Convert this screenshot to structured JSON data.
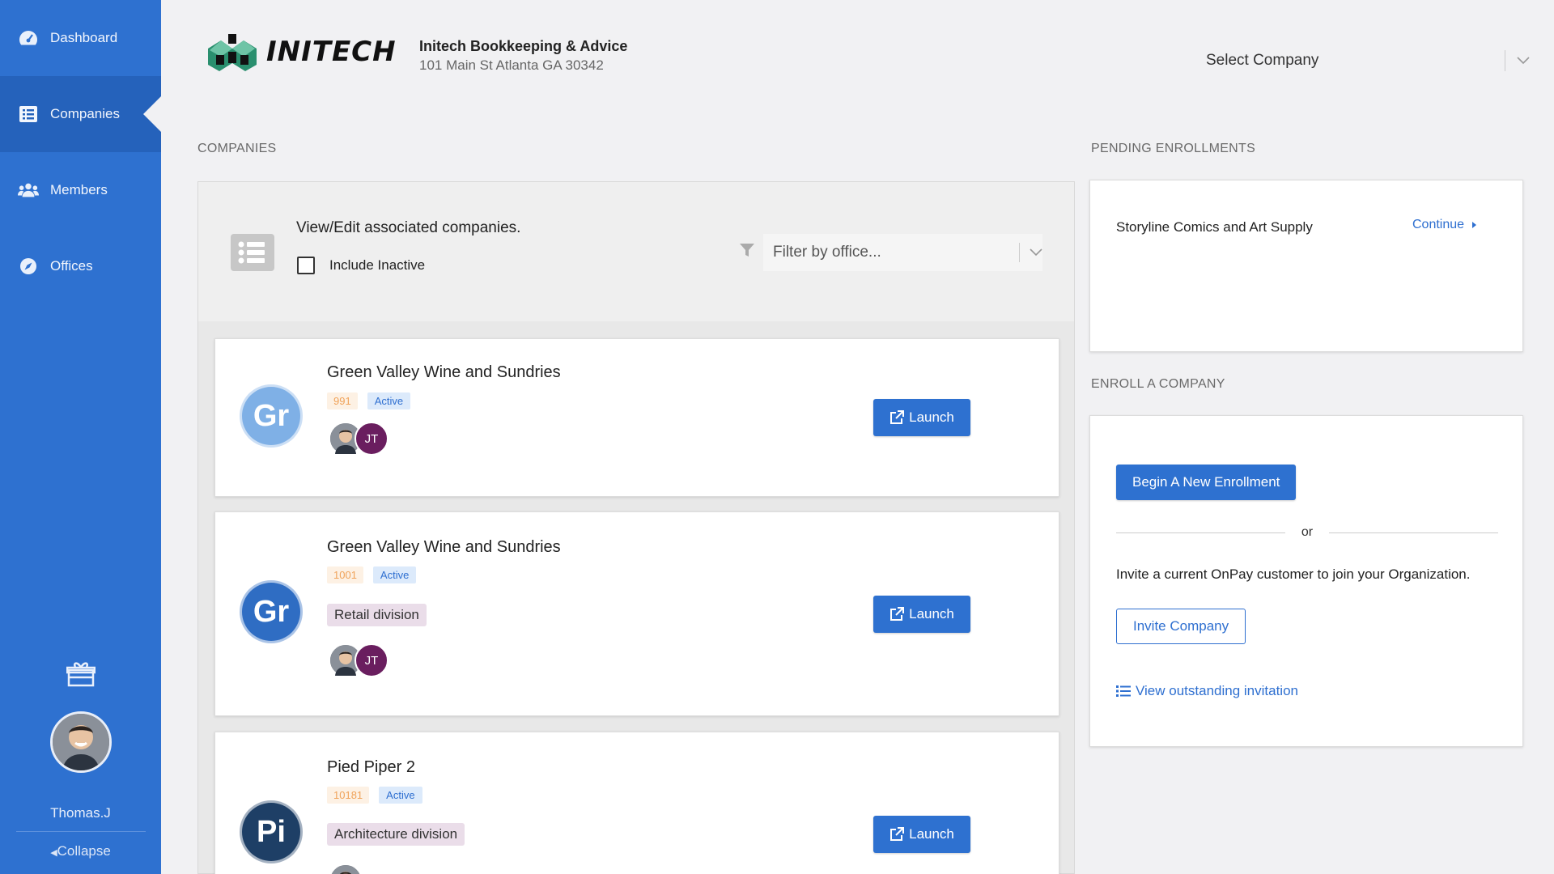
{
  "sidebar": {
    "items": [
      {
        "label": "Dashboard",
        "icon": "dashboard-icon"
      },
      {
        "label": "Companies",
        "icon": "list-icon",
        "active": true
      },
      {
        "label": "Members",
        "icon": "users-icon"
      },
      {
        "label": "Offices",
        "icon": "compass-icon"
      }
    ],
    "username": "Thomas.J",
    "collapse_label": "Collapse"
  },
  "header": {
    "logo_text": "INITECH",
    "org_name": "Initech Bookkeeping & Advice",
    "org_address": "101 Main St Atlanta GA 30342",
    "company_select_placeholder": "Select Company"
  },
  "companies": {
    "section_label": "COMPANIES",
    "panel_title": "View/Edit associated companies.",
    "include_inactive_label": "Include Inactive",
    "filter_placeholder": "Filter by office...",
    "launch_label": "Launch",
    "items": [
      {
        "initials": "Gr",
        "name": "Green Valley Wine and Sundries",
        "number": "991",
        "status": "Active",
        "division": "",
        "member_initials": "JT",
        "avatar_color": "#7fb0e6"
      },
      {
        "initials": "Gr",
        "name": "Green Valley Wine and Sundries",
        "number": "1001",
        "status": "Active",
        "division": "Retail division",
        "member_initials": "JT",
        "avatar_color": "#2f6dc3"
      },
      {
        "initials": "Pi",
        "name": "Pied Piper 2",
        "number": "10181",
        "status": "Active",
        "division": "Architecture division",
        "member_initials": "",
        "avatar_color": "#1e3f66"
      }
    ]
  },
  "pending": {
    "section_label": "PENDING ENROLLMENTS",
    "company_name": "Storyline Comics and Art Supply",
    "continue_label": "Continue"
  },
  "enroll": {
    "section_label": "ENROLL A COMPANY",
    "begin_label": "Begin A New Enrollment",
    "or_label": "or",
    "invite_text": "Invite a current OnPay customer to join your Organization.",
    "invite_button_label": "Invite Company",
    "view_invitation_label": "View outstanding invitation"
  }
}
